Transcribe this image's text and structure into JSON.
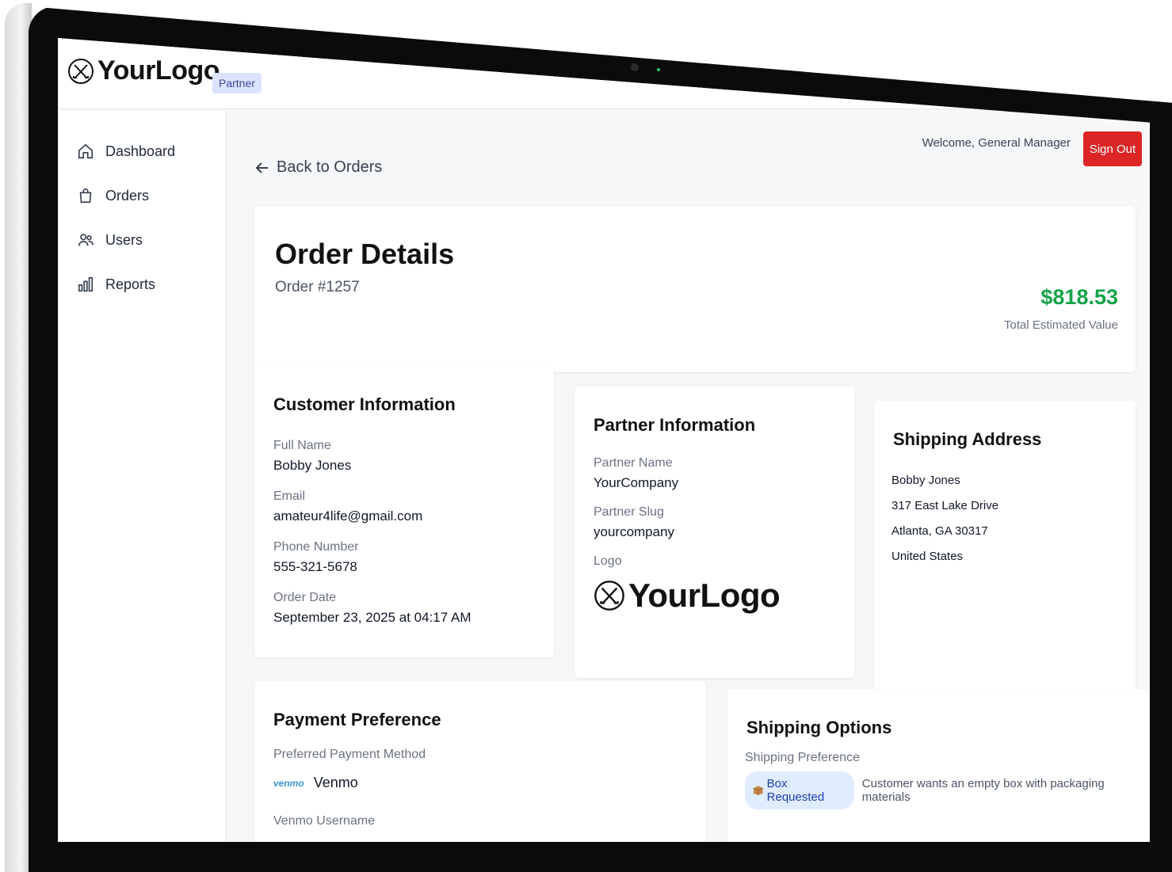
{
  "brand": {
    "logo_text": "YourLogo",
    "badge": "Partner"
  },
  "sidebar": {
    "items": [
      {
        "label": "Dashboard",
        "icon": "home-icon"
      },
      {
        "label": "Orders",
        "icon": "shopping-bag-icon"
      },
      {
        "label": "Users",
        "icon": "users-icon"
      },
      {
        "label": "Reports",
        "icon": "bar-chart-icon"
      }
    ]
  },
  "header": {
    "welcome": "Welcome, General Manager",
    "signout_label": "Sign Out"
  },
  "back_link": "Back to Orders",
  "order": {
    "title": "Order Details",
    "number": "Order #1257",
    "total": "$818.53",
    "total_label": "Total Estimated Value"
  },
  "customer": {
    "title": "Customer Information",
    "full_name_label": "Full Name",
    "full_name": "Bobby Jones",
    "email_label": "Email",
    "email": "amateur4life@gmail.com",
    "phone_label": "Phone Number",
    "phone": "555-321-5678",
    "date_label": "Order Date",
    "date": "September 23, 2025 at 04:17 AM"
  },
  "partner": {
    "title": "Partner Information",
    "name_label": "Partner Name",
    "name": "YourCompany",
    "slug_label": "Partner Slug",
    "slug": "yourcompany",
    "logo_label": "Logo",
    "logo_text": "YourLogo"
  },
  "shipping_address": {
    "title": "Shipping Address",
    "lines": [
      "Bobby Jones",
      "317 East Lake Drive",
      "Atlanta, GA 30317",
      "United States"
    ]
  },
  "payment": {
    "title": "Payment Preference",
    "method_label": "Preferred Payment Method",
    "venmo_logo": "venmo",
    "method": "Venmo",
    "username_label": "Venmo Username"
  },
  "shipping_options": {
    "title": "Shipping Options",
    "pref_label": "Shipping Preference",
    "badge": "Box Requested",
    "badge_icon": "package-icon",
    "description": "Customer wants an empty box with packaging materials"
  },
  "colors": {
    "signout": "#dc2626",
    "total": "#16a34a",
    "badge_bg": "#e0ecff",
    "partner_badge_bg": "#dbe3ff"
  }
}
